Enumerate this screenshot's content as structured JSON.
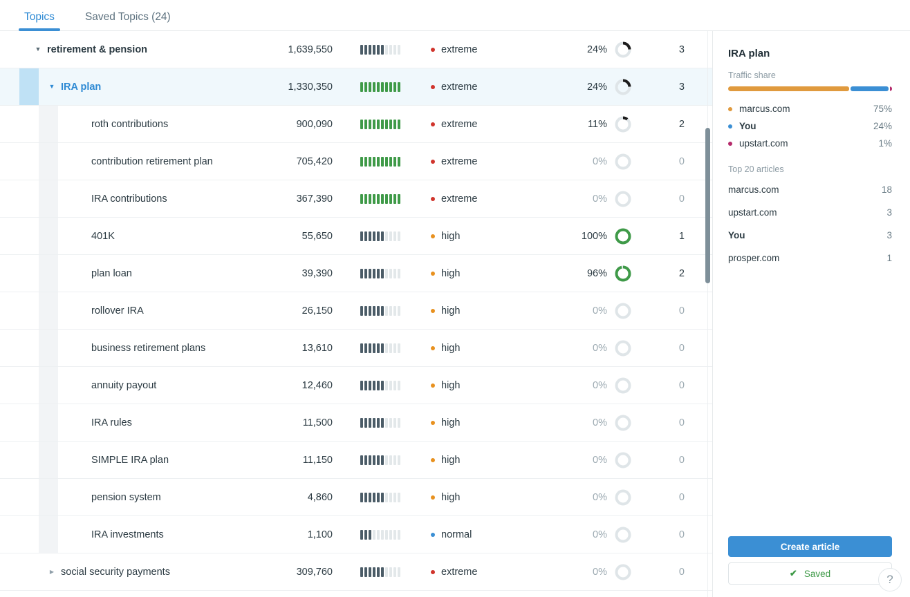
{
  "tabs": [
    {
      "label": "Topics",
      "active": true
    },
    {
      "label": "Saved Topics (24)",
      "active": false
    }
  ],
  "colors": {
    "accent": "#3b8fd4",
    "extreme": "#d0342c",
    "high": "#e8911f",
    "normal": "#3b8fd4",
    "green": "#3f9a48",
    "dark_bar": "#4b5c67",
    "empty_bar": "#e3e8ea",
    "marcus": "#e09a3e",
    "you": "#3b8fd4",
    "upstart": "#b52a6b"
  },
  "table": {
    "rows": [
      {
        "name": "retirement & pension",
        "level": 0,
        "caret": "open",
        "volume": "1,639,550",
        "bars_filled": 6,
        "bars_color": "dark",
        "difficulty": "extreme",
        "difficulty_color": "#d0342c",
        "percent": "24%",
        "percent_value": 24,
        "donut_color": "#1d1d1d",
        "count": "3"
      },
      {
        "name": "IRA plan",
        "level": 1,
        "caret": "open",
        "volume": "1,330,350",
        "bars_filled": 10,
        "bars_color": "green",
        "difficulty": "extreme",
        "difficulty_color": "#d0342c",
        "percent": "24%",
        "percent_value": 24,
        "donut_color": "#1d1d1d",
        "count": "3",
        "selected": true
      },
      {
        "name": "roth contributions",
        "level": 2,
        "caret": "none",
        "volume": "900,090",
        "bars_filled": 10,
        "bars_color": "green",
        "difficulty": "extreme",
        "difficulty_color": "#d0342c",
        "percent": "11%",
        "percent_value": 11,
        "donut_color": "#1d1d1d",
        "count": "2"
      },
      {
        "name": "contribution retirement plan",
        "level": 2,
        "caret": "none",
        "volume": "705,420",
        "bars_filled": 10,
        "bars_color": "green",
        "difficulty": "extreme",
        "difficulty_color": "#d0342c",
        "percent": "0%",
        "percent_value": 0,
        "donut_color": "#cfd6da",
        "count": "0"
      },
      {
        "name": "IRA contributions",
        "level": 2,
        "caret": "none",
        "volume": "367,390",
        "bars_filled": 10,
        "bars_color": "green",
        "difficulty": "extreme",
        "difficulty_color": "#d0342c",
        "percent": "0%",
        "percent_value": 0,
        "donut_color": "#cfd6da",
        "count": "0"
      },
      {
        "name": "401K",
        "level": 2,
        "caret": "none",
        "volume": "55,650",
        "bars_filled": 6,
        "bars_color": "dark",
        "difficulty": "high",
        "difficulty_color": "#e8911f",
        "percent": "100%",
        "percent_value": 100,
        "donut_color": "#3f9a48",
        "count": "1"
      },
      {
        "name": "plan loan",
        "level": 2,
        "caret": "none",
        "volume": "39,390",
        "bars_filled": 6,
        "bars_color": "dark",
        "difficulty": "high",
        "difficulty_color": "#e8911f",
        "percent": "96%",
        "percent_value": 96,
        "donut_color": "#3f9a48",
        "count": "2"
      },
      {
        "name": "rollover IRA",
        "level": 2,
        "caret": "none",
        "volume": "26,150",
        "bars_filled": 6,
        "bars_color": "dark",
        "difficulty": "high",
        "difficulty_color": "#e8911f",
        "percent": "0%",
        "percent_value": 0,
        "donut_color": "#cfd6da",
        "count": "0"
      },
      {
        "name": "business retirement plans",
        "level": 2,
        "caret": "none",
        "volume": "13,610",
        "bars_filled": 6,
        "bars_color": "dark",
        "difficulty": "high",
        "difficulty_color": "#e8911f",
        "percent": "0%",
        "percent_value": 0,
        "donut_color": "#cfd6da",
        "count": "0"
      },
      {
        "name": "annuity payout",
        "level": 2,
        "caret": "none",
        "volume": "12,460",
        "bars_filled": 6,
        "bars_color": "dark",
        "difficulty": "high",
        "difficulty_color": "#e8911f",
        "percent": "0%",
        "percent_value": 0,
        "donut_color": "#cfd6da",
        "count": "0"
      },
      {
        "name": "IRA rules",
        "level": 2,
        "caret": "none",
        "volume": "11,500",
        "bars_filled": 6,
        "bars_color": "dark",
        "difficulty": "high",
        "difficulty_color": "#e8911f",
        "percent": "0%",
        "percent_value": 0,
        "donut_color": "#cfd6da",
        "count": "0"
      },
      {
        "name": "SIMPLE IRA plan",
        "level": 2,
        "caret": "none",
        "volume": "11,150",
        "bars_filled": 6,
        "bars_color": "dark",
        "difficulty": "high",
        "difficulty_color": "#e8911f",
        "percent": "0%",
        "percent_value": 0,
        "donut_color": "#cfd6da",
        "count": "0"
      },
      {
        "name": "pension system",
        "level": 2,
        "caret": "none",
        "volume": "4,860",
        "bars_filled": 6,
        "bars_color": "dark",
        "difficulty": "high",
        "difficulty_color": "#e8911f",
        "percent": "0%",
        "percent_value": 0,
        "donut_color": "#cfd6da",
        "count": "0"
      },
      {
        "name": "IRA investments",
        "level": 2,
        "caret": "none",
        "volume": "1,100",
        "bars_filled": 3,
        "bars_color": "dark",
        "difficulty": "normal",
        "difficulty_color": "#3b8fd4",
        "percent": "0%",
        "percent_value": 0,
        "donut_color": "#cfd6da",
        "count": "0"
      },
      {
        "name": "social security payments",
        "level": 1,
        "caret": "closed",
        "volume": "309,760",
        "bars_filled": 6,
        "bars_color": "dark",
        "difficulty": "extreme",
        "difficulty_color": "#d0342c",
        "percent": "0%",
        "percent_value": 0,
        "donut_color": "#cfd6da",
        "count": "0"
      }
    ],
    "bars_total": 10
  },
  "sidebar": {
    "title": "IRA plan",
    "traffic_share_label": "Traffic share",
    "share_segments": [
      {
        "color": "#e09a3e",
        "pct": 74
      },
      {
        "color": "#3b8fd4",
        "pct": 23
      },
      {
        "color": "#b52a6b",
        "pct": 1.5
      }
    ],
    "legend": [
      {
        "name": "marcus.com",
        "value": "75%",
        "color": "#e09a3e",
        "bold": false
      },
      {
        "name": "You",
        "value": "24%",
        "color": "#3b8fd4",
        "bold": true
      },
      {
        "name": "upstart.com",
        "value": "1%",
        "color": "#b52a6b",
        "bold": false
      }
    ],
    "articles_label": "Top 20 articles",
    "articles": [
      {
        "name": "marcus.com",
        "value": "18",
        "bold": false
      },
      {
        "name": "upstart.com",
        "value": "3",
        "bold": false
      },
      {
        "name": "You",
        "value": "3",
        "bold": true
      },
      {
        "name": "prosper.com",
        "value": "1",
        "bold": false
      }
    ],
    "create_article_label": "Create article",
    "saved_label": "Saved",
    "help_label": "?"
  }
}
